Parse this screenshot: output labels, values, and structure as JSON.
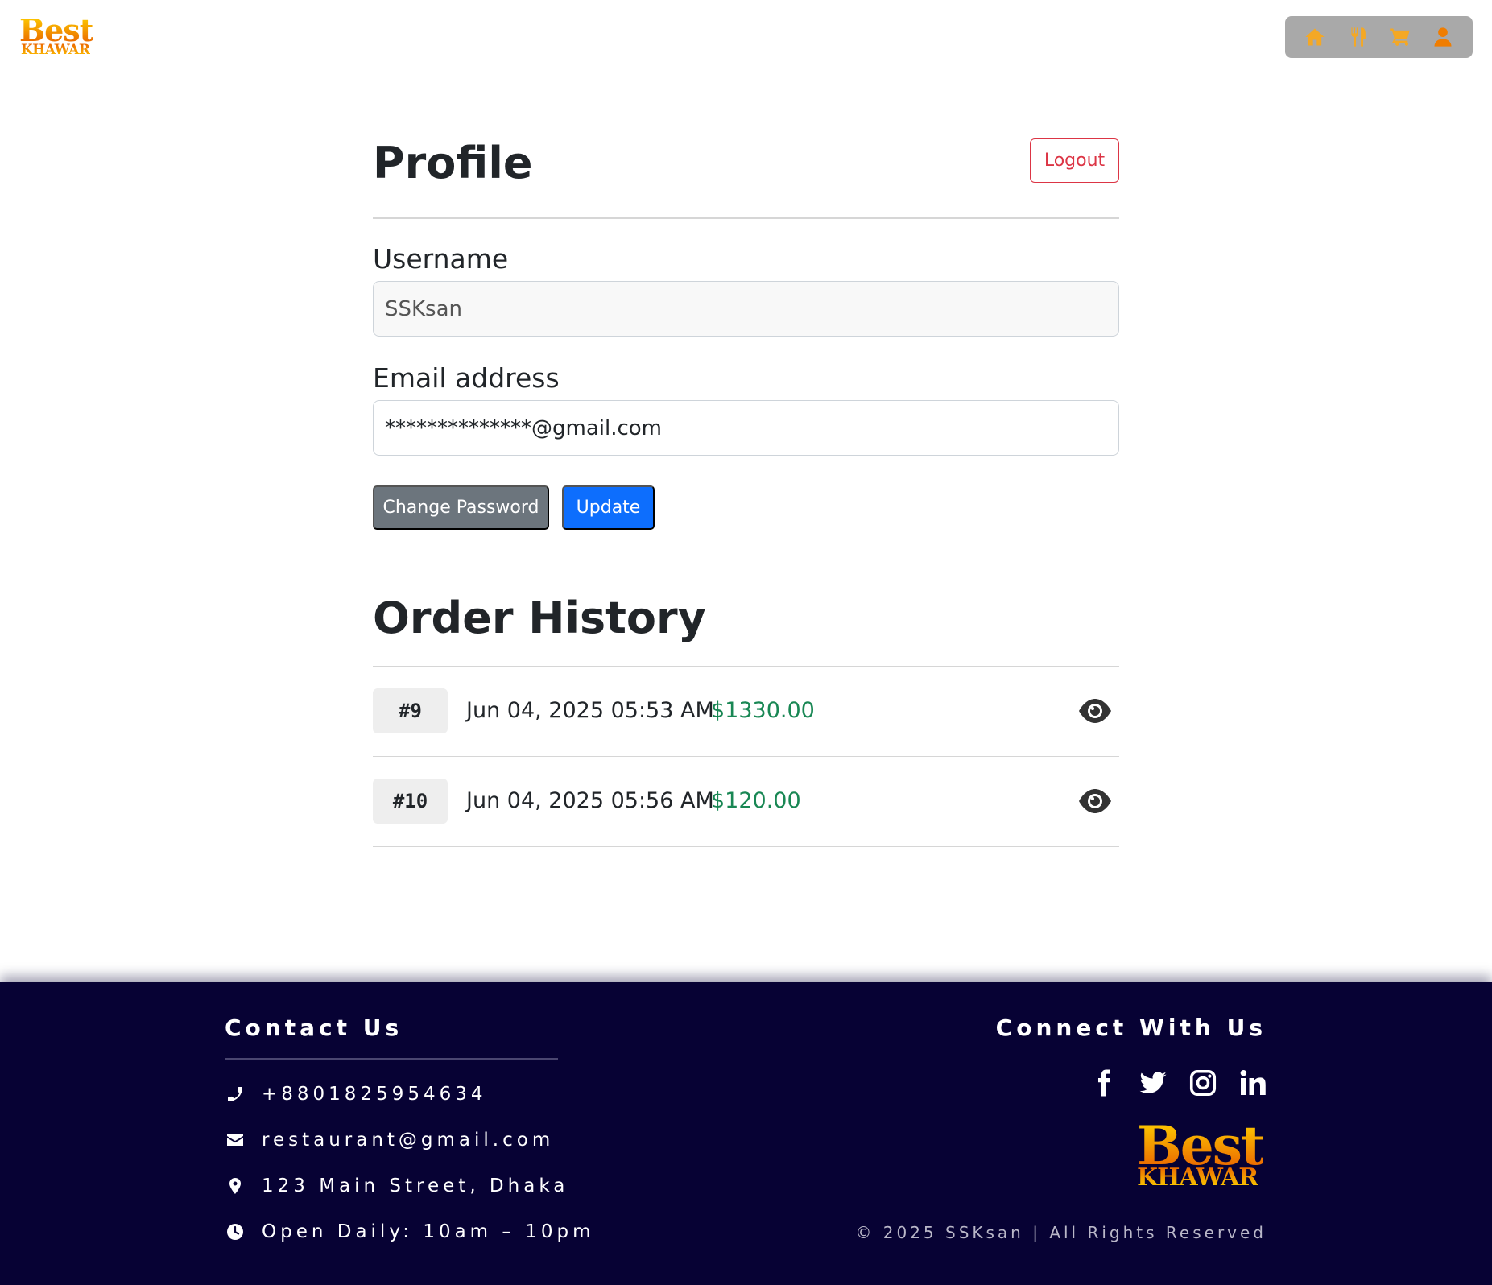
{
  "brand": {
    "logo_word_1": "Best",
    "logo_word_2": "KHAWAR"
  },
  "nav": {
    "icons": [
      "home-icon",
      "utensils-icon",
      "cart-icon",
      "user-icon"
    ],
    "icon_color": "#f4a825",
    "active_icon_color": "#f07d00",
    "background": "#a9a9a9"
  },
  "profile": {
    "title": "Profile",
    "logout_label": "Logout",
    "username_label": "Username",
    "username_value": "SSKsan",
    "email_label": "Email address",
    "email_value": "**************@gmail.com",
    "change_password_label": "Change Password",
    "update_label": "Update"
  },
  "orders": {
    "title": "Order History",
    "rows": [
      {
        "id": "#9",
        "date": "Jun 04, 2025 05:53 AM",
        "total": "$1330.00"
      },
      {
        "id": "#10",
        "date": "Jun 04, 2025 05:56 AM",
        "total": "$120.00"
      }
    ]
  },
  "footer": {
    "contact_title": "Contact Us",
    "phone": "+8801825954634",
    "email": "restaurant@gmail.com",
    "address": "123 Main Street, Dhaka",
    "hours": "Open Daily: 10am – 10pm",
    "connect_title": "Connect With Us",
    "socials": [
      "facebook-icon",
      "twitter-icon",
      "instagram-icon",
      "linkedin-icon"
    ],
    "copyright": "© 2025 SSKsan | All Rights Reserved",
    "background": "#070234"
  },
  "colors": {
    "danger": "#dc3545",
    "primary": "#0d6efd",
    "secondary": "#6c757d",
    "success": "#198754"
  }
}
